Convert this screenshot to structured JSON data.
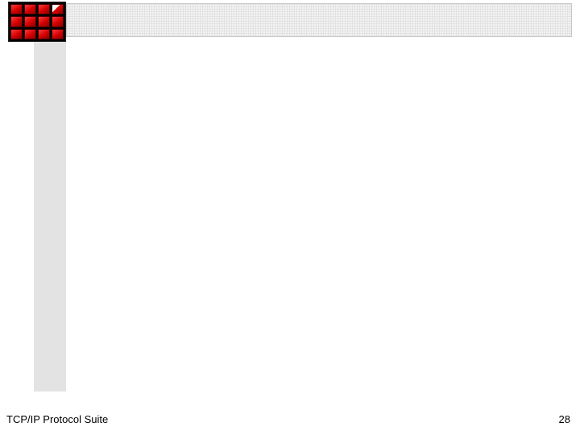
{
  "footer": {
    "title": "TCP/IP Protocol Suite",
    "page_number": "28"
  },
  "logo": {
    "name": "red-grid-logo",
    "grid_cols": 4,
    "grid_rows": 3
  }
}
